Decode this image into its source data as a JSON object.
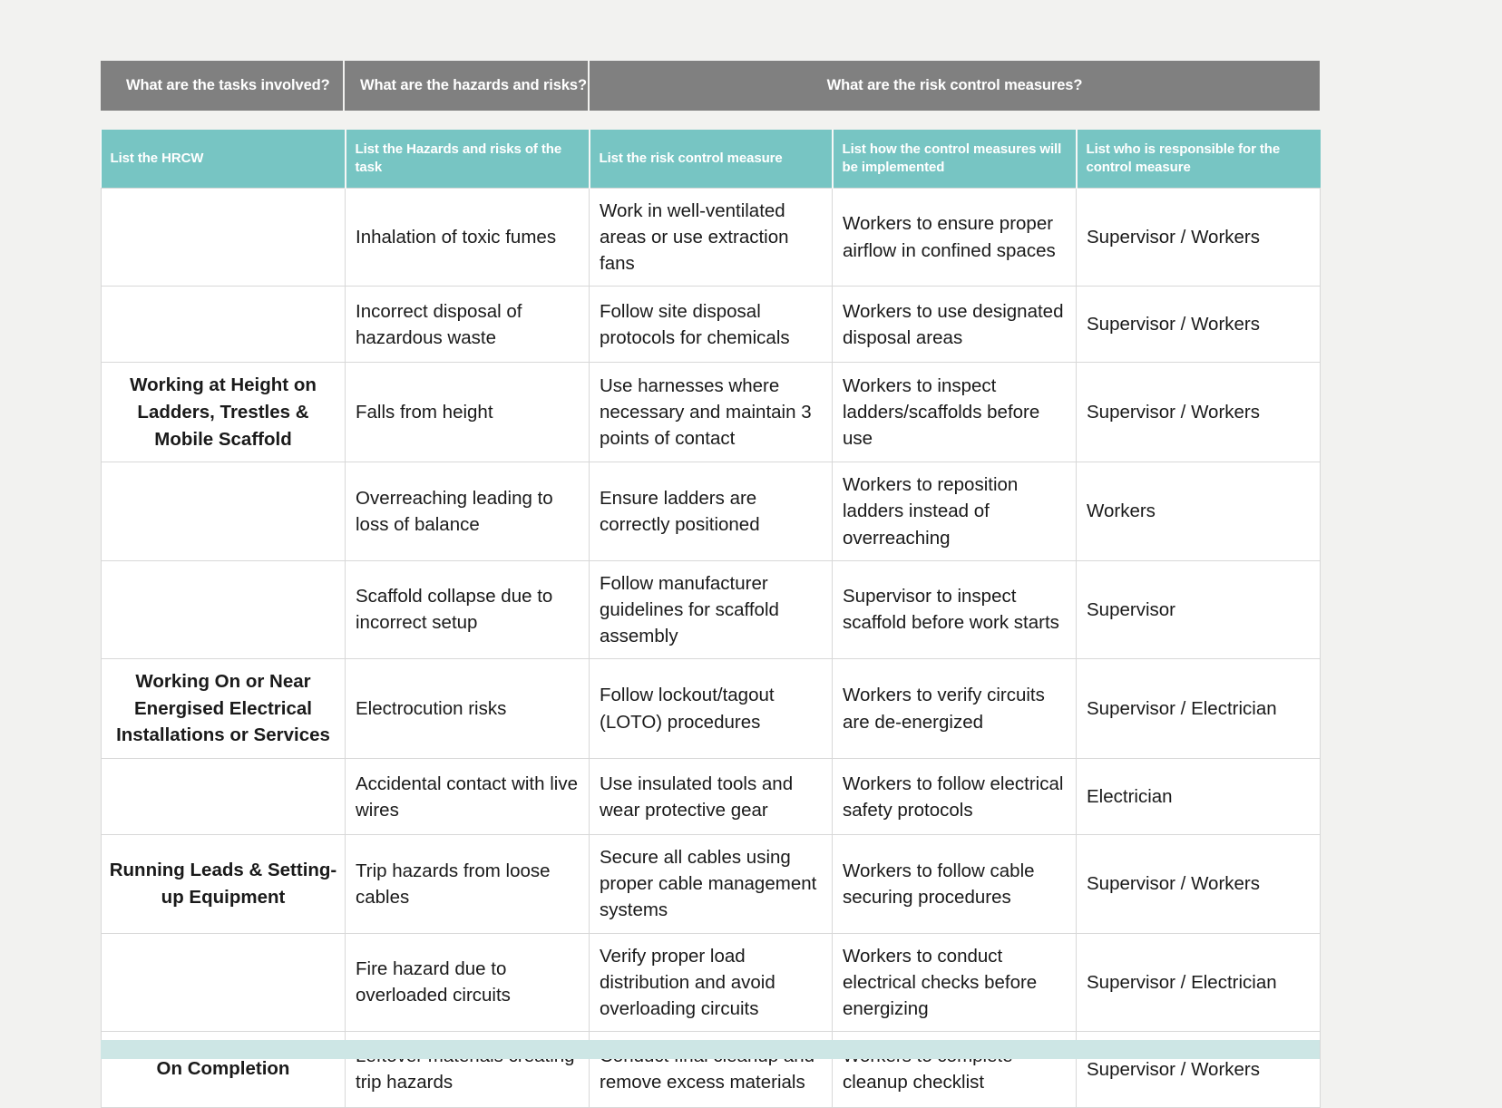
{
  "colors": {
    "banner_grey": "#808080",
    "header_teal": "#77c5c3",
    "bottom_bar_teal": "#cde6e5",
    "page_background": "#f2f2f0",
    "cell_border": "#d8d8d8"
  },
  "banner": {
    "groups": [
      "What are the tasks involved?",
      "What are the hazards and risks?",
      "What are the risk control measures?"
    ]
  },
  "table": {
    "columns": [
      "List the HRCW",
      "List the Hazards and risks of the task",
      "List the risk control measure",
      "List how the control measures will be implemented",
      "List who is responsible for the control measure"
    ],
    "rows": [
      {
        "task": "",
        "hazard": "Inhalation of toxic fumes",
        "control": "Work in well-ventilated areas or use extraction fans",
        "implementation": "Workers to ensure proper airflow in confined spaces",
        "responsible": "Supervisor / Workers"
      },
      {
        "task": "",
        "hazard": "Incorrect disposal of hazardous waste",
        "control": "Follow site disposal protocols for chemicals",
        "implementation": "Workers to use designated disposal areas",
        "responsible": "Supervisor / Workers"
      },
      {
        "task": "Working at Height on Ladders, Trestles & Mobile Scaffold",
        "hazard": "Falls from height",
        "control": "Use harnesses where necessary and maintain 3 points of contact",
        "implementation": "Workers to inspect ladders/scaffolds before use",
        "responsible": "Supervisor / Workers"
      },
      {
        "task": "",
        "hazard": "Overreaching leading to loss of balance",
        "control": "Ensure ladders are correctly positioned",
        "implementation": "Workers to reposition ladders instead of overreaching",
        "responsible": "Workers"
      },
      {
        "task": "",
        "hazard": "Scaffold collapse due to incorrect setup",
        "control": "Follow manufacturer guidelines for scaffold assembly",
        "implementation": "Supervisor to inspect scaffold before work starts",
        "responsible": "Supervisor"
      },
      {
        "task": "Working On or Near Energised Electrical Installations or Services",
        "hazard": "Electrocution risks",
        "control": "Follow lockout/tagout (LOTO) procedures",
        "implementation": "Workers to verify circuits are de-energized",
        "responsible": "Supervisor / Electrician"
      },
      {
        "task": "",
        "hazard": "Accidental contact with live wires",
        "control": "Use insulated tools and wear protective gear",
        "implementation": "Workers to follow electrical safety protocols",
        "responsible": "Electrician"
      },
      {
        "task": "Running Leads & Setting-up Equipment",
        "hazard": "Trip hazards from loose cables",
        "control": "Secure all cables using proper cable management systems",
        "implementation": "Workers to follow cable securing procedures",
        "responsible": "Supervisor / Workers"
      },
      {
        "task": "",
        "hazard": "Fire hazard due to overloaded circuits",
        "control": "Verify proper load distribution and avoid overloading circuits",
        "implementation": "Workers to conduct electrical checks before energizing",
        "responsible": "Supervisor / Electrician"
      },
      {
        "task": "On Completion",
        "hazard": "Leftover materials creating trip hazards",
        "control": "Conduct final cleanup and remove excess materials",
        "implementation": "Workers to complete cleanup checklist",
        "responsible": "Supervisor / Workers"
      }
    ]
  }
}
